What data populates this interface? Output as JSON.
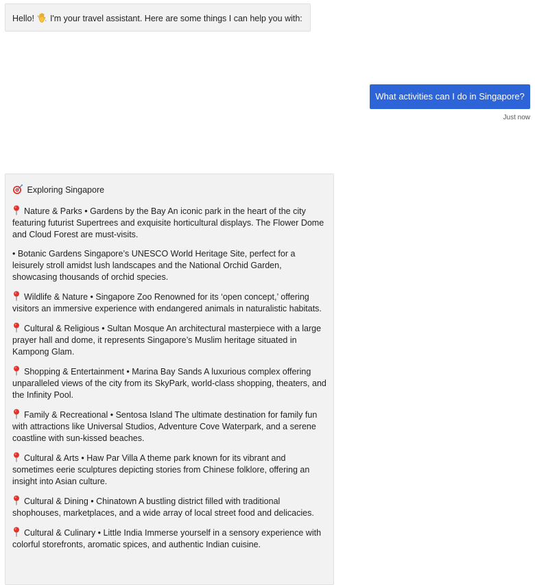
{
  "greeting": {
    "text_before": "Hello!",
    "emoji_icon": "waving-hand-icon",
    "text_after": "I'm your travel assistant. Here are some things I can help you with:"
  },
  "user_message": {
    "text": "What activities can I do in Singapore?",
    "timestamp": "Just now",
    "bubble_color": "#2d64d8"
  },
  "reply": {
    "heading_icon": "dart-target-icon",
    "heading": "Exploring Singapore",
    "paragraphs": [
      {
        "pin": true,
        "text": "Nature & Parks • Gardens by the Bay An iconic park in the heart of the city featuring futurist Supertrees and exquisite horticultural displays. The Flower Dome and Cloud Forest are must-visits."
      },
      {
        "pin": false,
        "text": "• Botanic Gardens Singapore’s UNESCO World Heritage Site, perfect for a leisurely stroll amidst lush landscapes and the National Orchid Garden, showcasing thousands of orchid species."
      },
      {
        "pin": true,
        "text": "Wildlife & Nature • Singapore Zoo Renowned for its ‘open concept,’ offering visitors an immersive experience with endangered animals in naturalistic habitats."
      },
      {
        "pin": true,
        "text": "Cultural & Religious • Sultan Mosque An architectural masterpiece with a large prayer hall and dome, it represents Singapore’s Muslim heritage situated in Kampong Glam."
      },
      {
        "pin": true,
        "text": "Shopping & Entertainment • Marina Bay Sands A luxurious complex offering unparalleled views of the city from its SkyPark, world-class shopping, theaters, and the Infinity Pool."
      },
      {
        "pin": true,
        "text": "Family & Recreational • Sentosa Island The ultimate destination for family fun with attractions like Universal Studios, Adventure Cove Waterpark, and a serene coastline with sun-kissed beaches."
      },
      {
        "pin": true,
        "text": "Cultural & Arts • Haw Par Villa A theme park known for its vibrant and sometimes eerie sculptures depicting stories from Chinese folklore, offering an insight into Asian culture."
      },
      {
        "pin": true,
        "text": "Cultural & Dining • Chinatown A bustling district filled with traditional shophouses, marketplaces, and a wide array of local street food and delicacies."
      },
      {
        "pin": true,
        "text": "Cultural & Culinary • Little India Immerse yourself in a sensory experience with colorful storefronts, aromatic spices, and authentic Indian cuisine."
      }
    ],
    "pin_icon": "round-pushpin-icon",
    "pin_color": "#e0332e"
  }
}
